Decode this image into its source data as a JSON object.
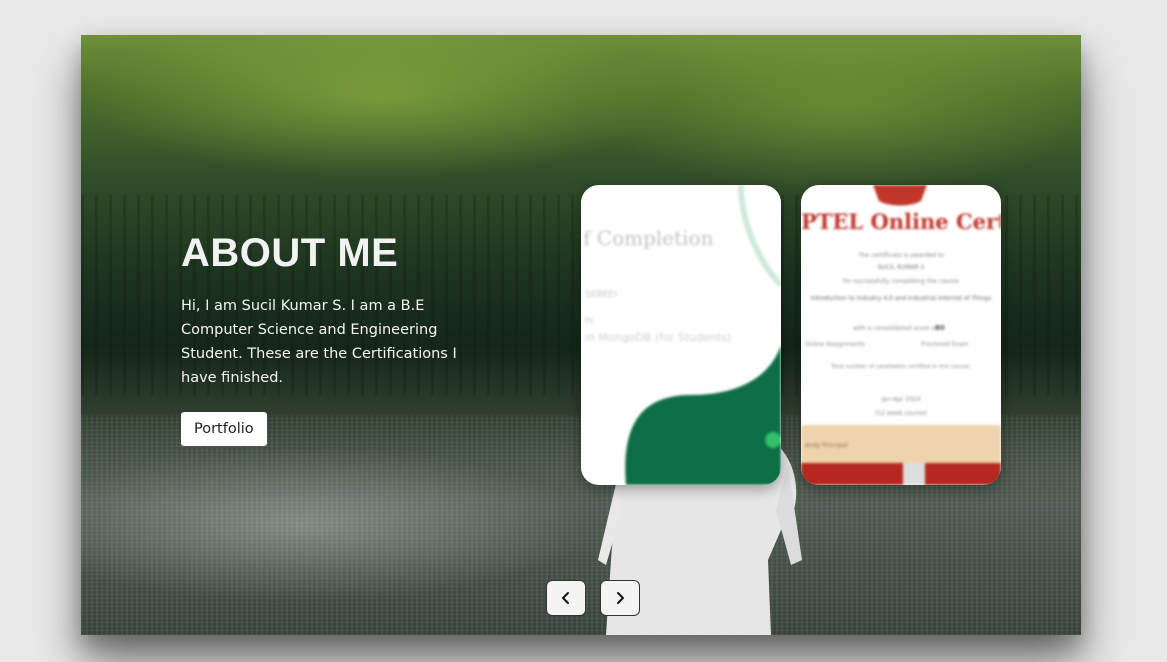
{
  "about": {
    "heading": "ABOUT ME",
    "description": "Hi, I am Sucil Kumar S. I am a B.E Computer Science and Engineering Student. These are the Certifications I have finished.",
    "portfolio_label": "Portfolio"
  },
  "cards": [
    {
      "name": "certificate-of-completion",
      "title_fragment": "f Completion",
      "line_1": "SEBEEI",
      "line_2": "ts",
      "line_3": "in MongoDB (for Students)"
    },
    {
      "name": "nptel-certificate",
      "title_fragment": "PTEL Online Certifica",
      "line_1": "The certificate is awarded to",
      "line_2": "SUCIL KUMAR S",
      "line_3": "for successfully completing the course",
      "line_4": "Introduction to Industry 4.0 and Industrial Internet of Things",
      "line_5": "with a consolidated score of",
      "score": "80",
      "line_6": "Online Assignments",
      "line_7": "Proctored Exam",
      "line_8": "Total number of candidates certified in this course:",
      "line_9": "Jan-Apr 2024",
      "line_10": "(12 week course)",
      "signatory": "Andy Principal"
    }
  ],
  "colors": {
    "card_accent_green": "#0e6e47",
    "nptel_red": "#b5281f",
    "nptel_peach": "#efd3ad"
  },
  "navigation": {
    "prev_icon": "chevron-left-icon",
    "next_icon": "chevron-right-icon"
  }
}
